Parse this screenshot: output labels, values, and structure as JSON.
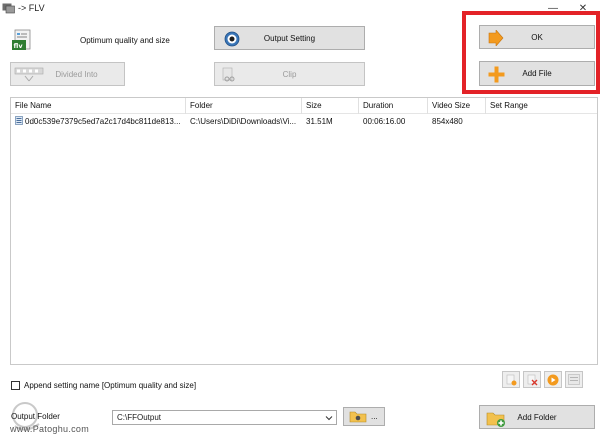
{
  "window": {
    "title": "-> FLV",
    "minimize": "—",
    "close": "✕"
  },
  "profile": {
    "label": "Optimum quality and size"
  },
  "toolbar": {
    "output_setting": "Output Setting",
    "divided_into": "Divided Into",
    "clip": "Clip",
    "ok": "OK",
    "add_file": "Add File"
  },
  "table": {
    "columns": [
      "File Name",
      "Folder",
      "Size",
      "Duration",
      "Video Size",
      "Set Range"
    ],
    "rows": [
      {
        "file_name": "0d0c539e7379c5ed7a2c17d4bc811de813...",
        "folder": "C:\\Users\\DiDi\\Downloads\\Vi...",
        "size": "31.51M",
        "duration": "00:06:16.00",
        "video_size": "854x480",
        "set_range": ""
      }
    ]
  },
  "options": {
    "append_setting_name": "Append setting name [Optimum quality and size]"
  },
  "output": {
    "label": "Output Folder",
    "path": "C:\\FFOutput",
    "browse_ellipsis": "...",
    "add_folder": "Add Folder"
  },
  "watermark": {
    "site": "www.Patoghu.com"
  },
  "colors": {
    "highlight": "#e32227",
    "button_bg": "#e1e1e1",
    "accent_orange": "#f39a1e"
  }
}
